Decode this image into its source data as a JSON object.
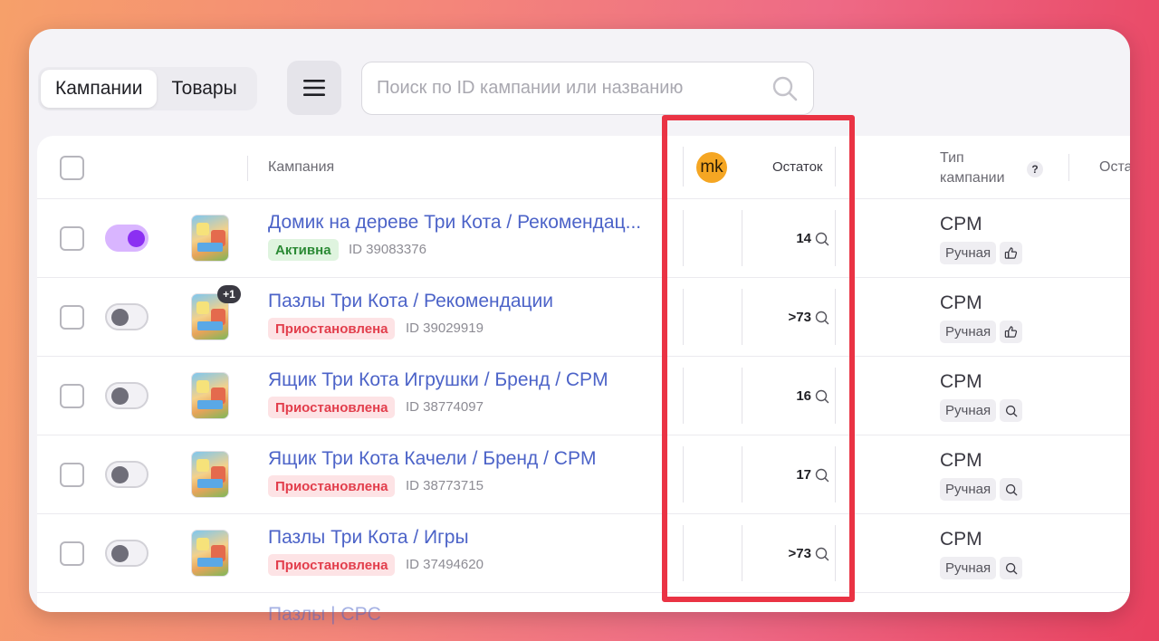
{
  "tabs": {
    "campaigns": "Кампании",
    "products": "Товары"
  },
  "search": {
    "placeholder": "Поиск по ID кампании или названию"
  },
  "header": {
    "campaign": "Кампания",
    "avatar_initials": "mk",
    "remainder": "Остаток",
    "type_line1": "Тип",
    "type_line2": "кампании",
    "help": "?",
    "cut_column": "Оста"
  },
  "colors": {
    "accent": "#8b2ff2",
    "link": "#4c63c8",
    "highlight": "#ea3344",
    "active": "#2b8a35",
    "paused": "#e23e4c"
  },
  "rows": [
    {
      "name": "Домик на дереве Три Кота / Рекомендац...",
      "status": "Активна",
      "status_type": "active",
      "id": "ID 39083376",
      "count": "14",
      "type": "CPM",
      "mode": "Ручная",
      "mode_icon": "thumbs-up-icon",
      "enabled": true,
      "extra_badge": ""
    },
    {
      "name": "Пазлы Три Кота / Рекомендации",
      "status": "Приостановлена",
      "status_type": "paused",
      "id": "ID 39029919",
      "count": ">73",
      "type": "CPM",
      "mode": "Ручная",
      "mode_icon": "thumbs-up-icon",
      "enabled": false,
      "extra_badge": "+1"
    },
    {
      "name": "Ящик Три Кота Игрушки / Бренд / CPM",
      "status": "Приостановлена",
      "status_type": "paused",
      "id": "ID 38774097",
      "count": "16",
      "type": "CPM",
      "mode": "Ручная",
      "mode_icon": "search-icon",
      "enabled": false,
      "extra_badge": ""
    },
    {
      "name": "Ящик Три Кота Качели / Бренд / CPM",
      "status": "Приостановлена",
      "status_type": "paused",
      "id": "ID 38773715",
      "count": "17",
      "type": "CPM",
      "mode": "Ручная",
      "mode_icon": "search-icon",
      "enabled": false,
      "extra_badge": ""
    },
    {
      "name": "Пазлы Три Кота / Игры",
      "status": "Приостановлена",
      "status_type": "paused",
      "id": "ID 37494620",
      "count": ">73",
      "type": "CPM",
      "mode": "Ручная",
      "mode_icon": "search-icon",
      "enabled": false,
      "extra_badge": ""
    }
  ],
  "peek_row": {
    "name": "Пазлы | CPC"
  }
}
